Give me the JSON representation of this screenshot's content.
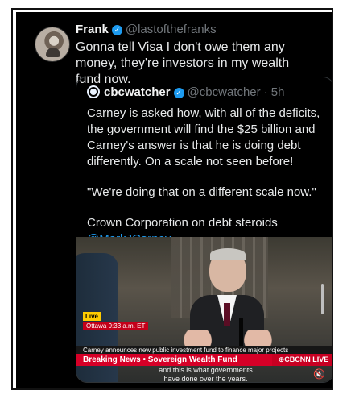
{
  "tweet": {
    "author": "Frank",
    "handle": "@lastofthefranks",
    "text": "Gonna tell Visa I don't owe them any money, they're investors in my wealth fund now."
  },
  "quote": {
    "author": "cbcwatcher",
    "handle": "@cbcwatcher",
    "time": "· 5h",
    "paragraph1": "Carney is asked how, with all of the deficits, the government will find the $25 billion and Carney's answer is that he is doing debt differently. On a scale not seen before!",
    "paragraph2": "\"We're doing that on a different scale now.\"",
    "paragraph3": "Crown Corporation on debt steroids",
    "mention": "@MarkJCarney"
  },
  "video": {
    "live": "Live",
    "location_time": "Ottawa 9:33 a.m. ET",
    "headline": "Carney announces new public investment fund to finance major projects",
    "breaking": "Breaking News • Sovereign Wealth Fund",
    "network": "⊕CBCNN LIVE",
    "caption_line1": "and this is what governments",
    "caption_line2": "have done over the years.",
    "mute_icon": "🔇"
  }
}
